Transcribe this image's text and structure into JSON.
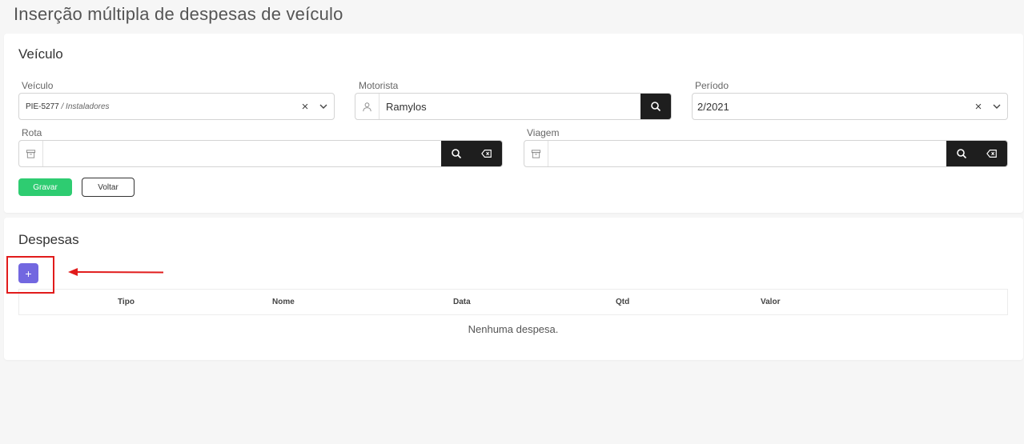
{
  "page": {
    "title": "Inserção múltipla de despesas de veículo"
  },
  "vehicle_card": {
    "title": "Veículo",
    "veiculo": {
      "label": "Veículo",
      "plate": "PIE-5277",
      "group": " / Instaladores"
    },
    "motorista": {
      "label": "Motorista",
      "value": "Ramylos"
    },
    "periodo": {
      "label": "Período",
      "value": "2/2021"
    },
    "rota": {
      "label": "Rota",
      "value": ""
    },
    "viagem": {
      "label": "Viagem",
      "value": ""
    },
    "save_label": "Gravar",
    "back_label": "Voltar",
    "clear_symbol": "×"
  },
  "expenses_card": {
    "title": "Despesas",
    "add_label": "+",
    "columns": [
      "Tipo",
      "Nome",
      "Data",
      "Qtd",
      "Valor"
    ],
    "empty_message": "Nenhuma despesa."
  },
  "icons": {
    "search": "search-icon",
    "clear": "close-icon",
    "dropdown": "chevron-down-icon",
    "user": "user-icon",
    "archive": "archive-icon",
    "backspace": "backspace-icon"
  },
  "colors": {
    "save": "#2ecc71",
    "add": "#7267e0",
    "dark_button": "#1e1e1e",
    "annotation": "#e11b1b"
  }
}
